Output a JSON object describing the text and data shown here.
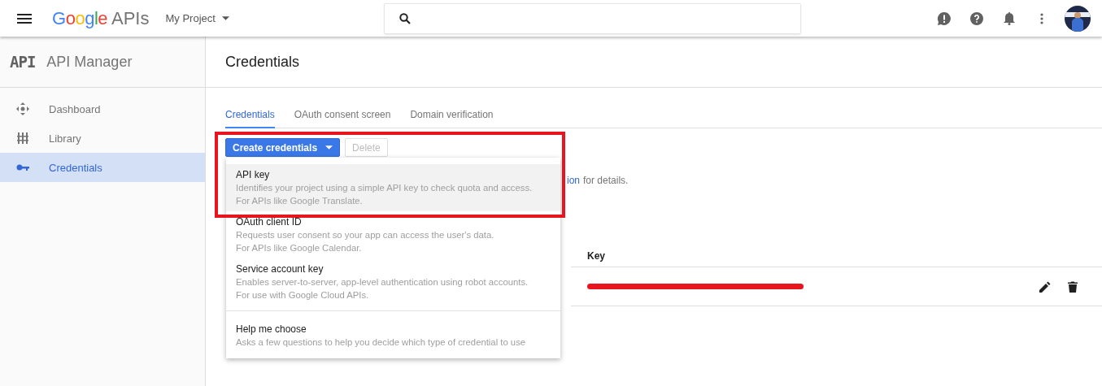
{
  "topbar": {
    "logo": "Google",
    "product": "APIs",
    "project": "My Project"
  },
  "sidebar": {
    "badge": "API",
    "title": "API Manager",
    "items": [
      {
        "label": "Dashboard",
        "kind": "dashboard",
        "selected": false
      },
      {
        "label": "Library",
        "kind": "library",
        "selected": false
      },
      {
        "label": "Credentials",
        "kind": "key",
        "selected": true
      }
    ]
  },
  "page": {
    "title": "Credentials",
    "tabs": [
      {
        "label": "Credentials",
        "selected": true
      },
      {
        "label": "OAuth consent screen",
        "selected": false
      },
      {
        "label": "Domain verification",
        "selected": false
      }
    ],
    "create_button": "Create credentials",
    "delete_button": "Delete",
    "delete_disabled": true,
    "info_link": "ion",
    "info_text": "for details.",
    "table": {
      "columns": [
        "Key"
      ]
    }
  },
  "menu": {
    "items": [
      {
        "kind": "option",
        "title": "API key",
        "lines": [
          "Identifies your project using a simple API key to check quota and access.",
          "For APIs like Google Translate."
        ],
        "selected": true
      },
      {
        "kind": "option",
        "title": "OAuth client ID",
        "lines": [
          "Requests user consent so your app can access the user's data.",
          "For APIs like Google Calendar."
        ],
        "selected": false
      },
      {
        "kind": "option",
        "title": "Service account key",
        "lines": [
          "Enables server-to-server, app-level authentication using robot accounts.",
          "For use with Google Cloud APIs."
        ],
        "selected": false
      },
      {
        "kind": "help",
        "title": "Help me choose",
        "lines": [
          "Asks a few questions to help you decide which type of credential to use"
        ],
        "selected": false
      }
    ]
  }
}
